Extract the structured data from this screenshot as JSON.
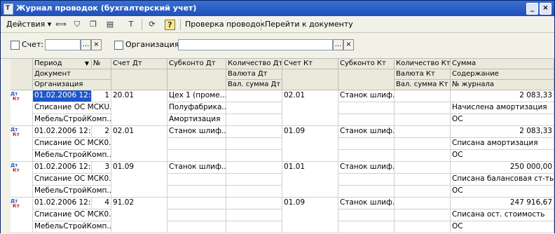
{
  "window": {
    "title": "Журнал проводок (бухгалтерский учет)"
  },
  "toolbar": {
    "actions_label": "Действия",
    "check_label": "Проверка проводок",
    "goto_label": "Перейти к документу",
    "help_glyph": "?"
  },
  "filter": {
    "account_label": "Счет:",
    "account_value": "",
    "org_label": "Организация:",
    "org_value": "",
    "select_glyph": "...",
    "clear_glyph": "×"
  },
  "columns": {
    "period": "Период",
    "num": "№",
    "document": "Документ",
    "organization": "Организация",
    "debit_account": "Счет Дт",
    "subconto_dt": "Субконто Дт",
    "qty_dt": "Количество Дт",
    "currency_dt": "Валюта Дт",
    "val_sum_dt": "Вал. сумма Дт",
    "credit_account": "Счет Кт",
    "subconto_kt": "Субконто Кт",
    "qty_kt": "Количество Кт",
    "currency_kt": "Валюта Кт",
    "val_sum_kt": "Вал. сумма Кт",
    "sum": "Сумма",
    "content": "Содержание",
    "journal_no": "№ журнала"
  },
  "icon_label": {
    "dt": "Дт",
    "kt": "Кт"
  },
  "rows": [
    {
      "period": "01.02.2006 12:...",
      "num": "1",
      "document": "Списание ОС МСКU...",
      "organization": "МебельСтройКомп...",
      "debit": "20.01",
      "sub_dt": [
        "Цех 1 (проме...",
        "Полуфабрика...",
        "Амортизация"
      ],
      "credit": "02.01",
      "sub_kt": [
        "Станок шлиф...",
        "",
        ""
      ],
      "sum": "2 083,33",
      "content": "Начислена амортизация",
      "journal": "ОС"
    },
    {
      "period": "01.02.2006 12:...",
      "num": "2",
      "document": "Списание ОС МСК0...",
      "organization": "МебельСтройКомп...",
      "debit": "02.01",
      "sub_dt": [
        "Станок шлиф...",
        "",
        ""
      ],
      "credit": "01.09",
      "sub_kt": [
        "Станок шлиф...",
        "",
        ""
      ],
      "sum": "2 083,33",
      "content": "Списана амортизация",
      "journal": "ОС"
    },
    {
      "period": "01.02.2006 12:...",
      "num": "3",
      "document": "Списание ОС МСК0...",
      "organization": "МебельСтройКомп...",
      "debit": "01.09",
      "sub_dt": [
        "Станок шлиф...",
        "",
        ""
      ],
      "credit": "01.01",
      "sub_kt": [
        "Станок шлиф...",
        "",
        ""
      ],
      "sum": "250 000,00",
      "content": "Списана балансовая ст-ть",
      "journal": "ОС"
    },
    {
      "period": "01.02.2006 12:...",
      "num": "4",
      "document": "Списание ОС МСК0...",
      "organization": "МебельСтройКомп...",
      "debit": "91.02",
      "sub_dt": [
        "",
        "",
        ""
      ],
      "credit": "01.09",
      "sub_kt": [
        "Станок шлиф...",
        "",
        ""
      ],
      "sum": "247 916,67",
      "content": "Списана ост. стоимость",
      "journal": "ОС"
    }
  ]
}
